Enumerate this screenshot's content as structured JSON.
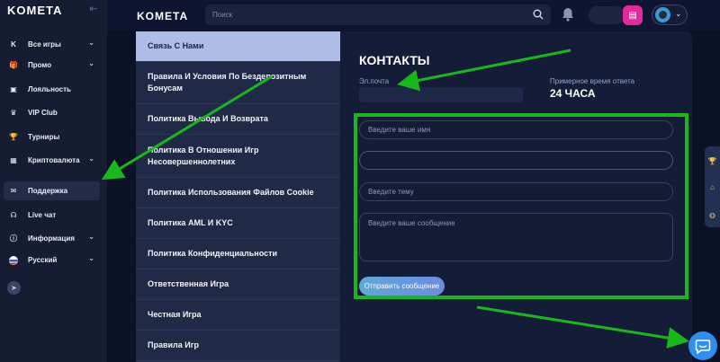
{
  "sidebar": {
    "brand": "KOMETA",
    "items": [
      {
        "label": "Все игры",
        "icon": "games-icon",
        "has_chevron": true
      },
      {
        "label": "Промо",
        "icon": "promo-icon",
        "has_chevron": true
      },
      {
        "label": "Лояльность",
        "icon": "loyalty-icon",
        "has_chevron": false
      },
      {
        "label": "VIP Club",
        "icon": "vip-crown-icon",
        "has_chevron": false
      },
      {
        "label": "Турниры",
        "icon": "trophy-icon",
        "has_chevron": false
      },
      {
        "label": "Криптовалюта",
        "icon": "crypto-icon",
        "has_chevron": true
      },
      {
        "label": "Поддержка",
        "icon": "support-icon",
        "has_chevron": false,
        "active": true
      },
      {
        "label": "Live чат",
        "icon": "headset-icon",
        "has_chevron": false
      },
      {
        "label": "Информация",
        "icon": "info-icon",
        "has_chevron": true
      },
      {
        "label": "Русский",
        "icon": "flag-ru-icon",
        "has_chevron": true
      }
    ]
  },
  "header": {
    "brand": "KOMETA",
    "search_placeholder": "Поиск"
  },
  "menu": {
    "items": [
      {
        "label": "Связь С Нами",
        "active": true
      },
      {
        "label": "Правила И Условия По Бездепозитным Бонусам"
      },
      {
        "label": "Политика Вывода И Возврата"
      },
      {
        "label": "Политика В Отношении Игр Несовершеннолетних"
      },
      {
        "label": "Политика Использования Файлов Cookie"
      },
      {
        "label": "Политика AML И KYC"
      },
      {
        "label": "Политика Конфиденциальности"
      },
      {
        "label": "Ответственная Игра"
      },
      {
        "label": "Честная Игра"
      },
      {
        "label": "Правила Игр"
      }
    ]
  },
  "contacts": {
    "title": "КОНТАКТЫ",
    "email_label": "Эл.почта",
    "response_label": "Примерное время ответа",
    "response_value": "24 ЧАСА",
    "form": {
      "name_placeholder": "Введите ваше имя",
      "email_value": "",
      "subject_placeholder": "Введите тему",
      "message_placeholder": "Введите ваше сообщение",
      "submit_label": "Отправить сообщение"
    }
  },
  "colors": {
    "accent": "#2f8ff0",
    "annotation": "#18b81c",
    "wallet": "#e22a9a"
  }
}
